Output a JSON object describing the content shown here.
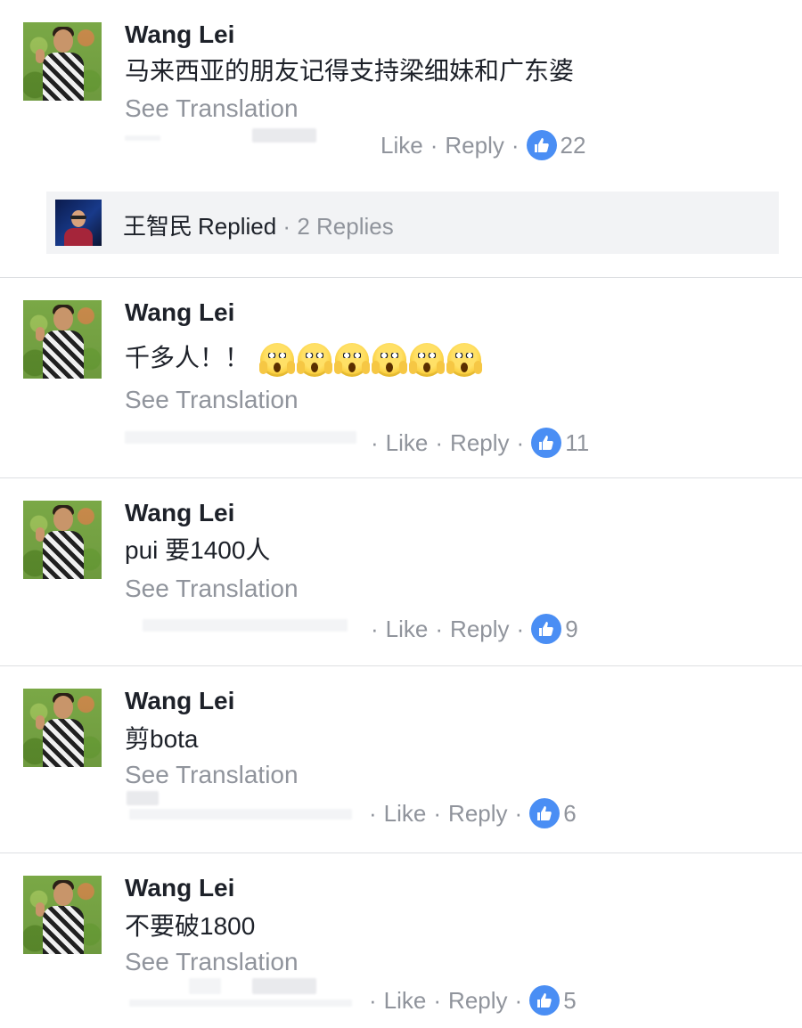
{
  "comments": [
    {
      "author": "Wang Lei",
      "text": "马来西亚的朋友记得支持梁细妹和广东婆",
      "translate": "See Translation",
      "like": "Like",
      "reply": "Reply",
      "likes": "22"
    },
    {
      "author": "Wang Lei",
      "text": "千多人！！",
      "emoji_count": 6,
      "translate": "See Translation",
      "like": "Like",
      "reply": "Reply",
      "likes": "11"
    },
    {
      "author": "Wang Lei",
      "text": "pui 要1400人",
      "translate": "See Translation",
      "like": "Like",
      "reply": "Reply",
      "likes": "9"
    },
    {
      "author": "Wang Lei",
      "text": "剪bota",
      "translate": "See Translation",
      "like": "Like",
      "reply": "Reply",
      "likes": "6"
    },
    {
      "author": "Wang Lei",
      "text": "不要破1800",
      "translate": "See Translation",
      "like": "Like",
      "reply": "Reply",
      "likes": "5"
    }
  ],
  "reply_bar": {
    "name": "王智民",
    "status": "Replied",
    "count": "2 Replies"
  },
  "separator": "·",
  "colors": {
    "like_blue": "#4a8ef4",
    "meta_gray": "#90949c",
    "text": "#1d2129"
  },
  "icons": {
    "like": "thumbs-up-icon",
    "emoji": "face-screaming-in-fear-emoji"
  }
}
